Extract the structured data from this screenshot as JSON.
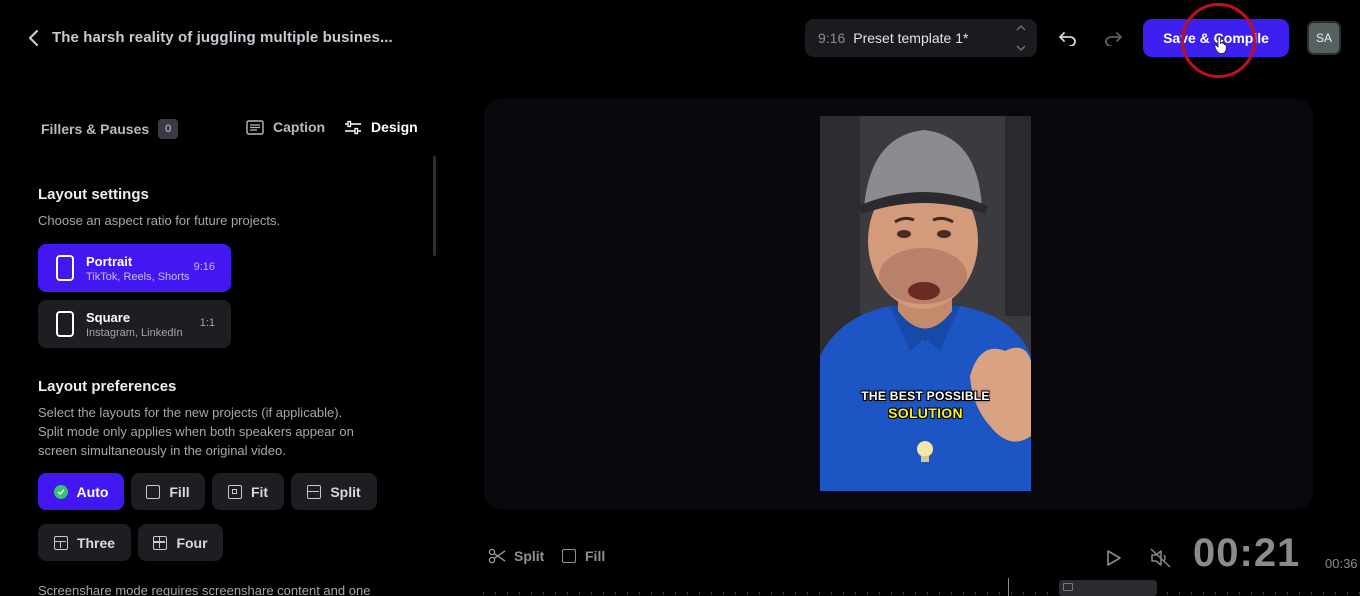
{
  "header": {
    "project_title": "The harsh reality of juggling multiple busines...",
    "template_ratio": "9:16",
    "template_name": "Preset template 1*",
    "save_label": "Save & Compile",
    "avatar_initials": "SA"
  },
  "tabs": {
    "fillers_label": "Fillers & Pauses",
    "fillers_count": "0",
    "caption_label": "Caption",
    "design_label": "Design"
  },
  "layout_settings": {
    "title": "Layout settings",
    "description": "Choose an aspect ratio for future projects.",
    "options": [
      {
        "name": "Portrait",
        "sub": "TikTok, Reels, Shorts",
        "ratio": "9:16",
        "selected": true
      },
      {
        "name": "Square",
        "sub": "Instagram, LinkedIn",
        "ratio": "1:1",
        "selected": false
      }
    ]
  },
  "layout_preferences": {
    "title": "Layout preferences",
    "description_lines": [
      "Select the layouts for the new projects (if applicable).",
      "Split mode only applies when both speakers appear on",
      "screen simultaneously in the original video."
    ],
    "buttons": [
      "Auto",
      "Fill",
      "Fit",
      "Split",
      "Three",
      "Four"
    ],
    "selected": "Auto",
    "screenshare_note": "Screenshare mode requires screenshare content and one"
  },
  "preview": {
    "caption_line1": "THE BEST POSSIBLE",
    "caption_line2": "SOLUTION"
  },
  "toolbar": {
    "split_label": "Split",
    "fill_label": "Fill",
    "timecode": "00:21",
    "duration": "00:36"
  },
  "colors": {
    "accent": "#4317f2",
    "save_button": "#3d1ff0",
    "caption_highlight": "#f9f01c",
    "check": "#34c46b",
    "click_ring": "#c0101c"
  }
}
